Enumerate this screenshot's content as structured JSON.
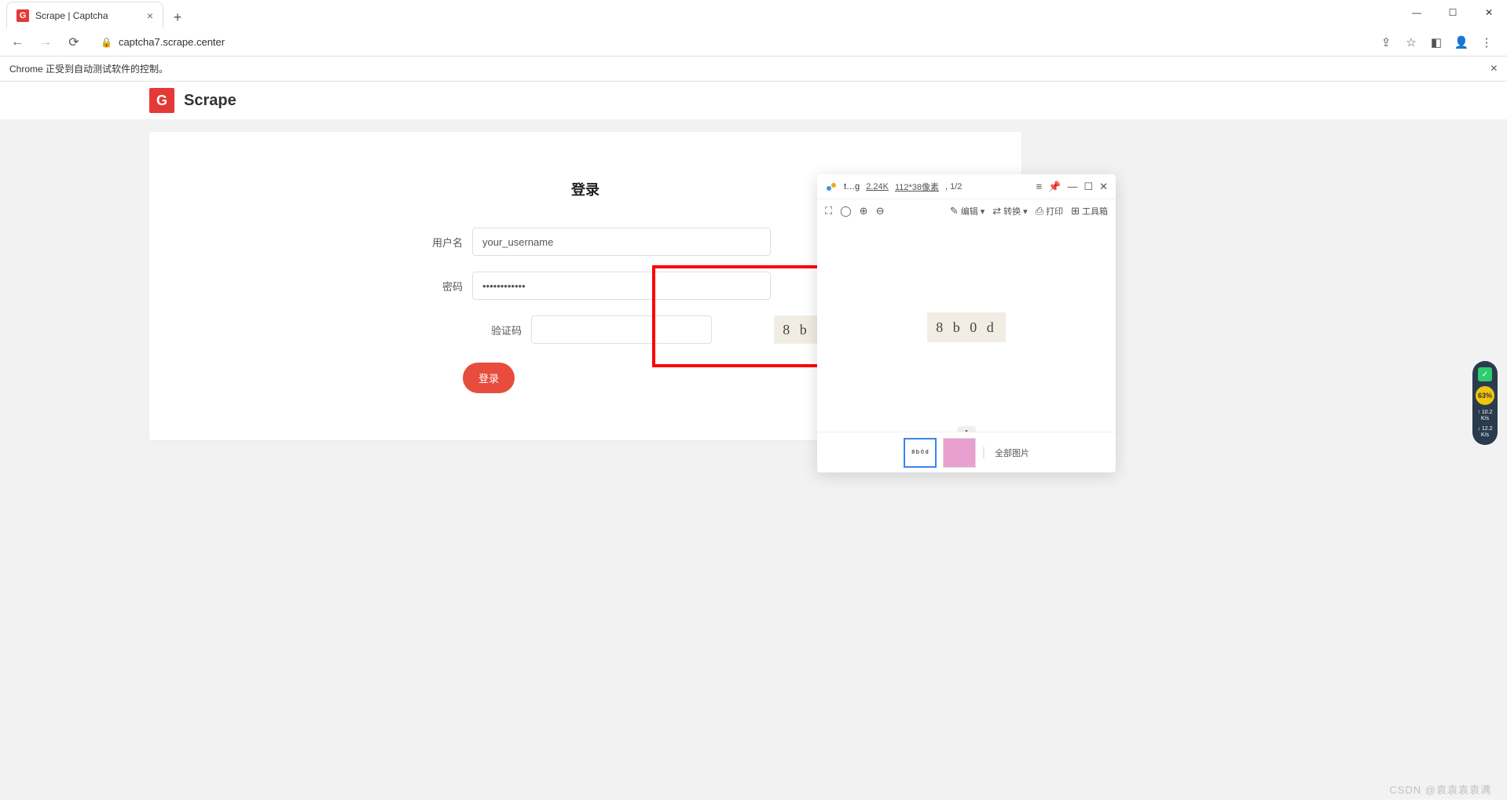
{
  "browser": {
    "tab_title": "Scrape | Captcha",
    "url": "captcha7.scrape.center",
    "automation_notice": "Chrome 正受到自动测试软件的控制。"
  },
  "site": {
    "logo_letter": "G",
    "title": "Scrape"
  },
  "login": {
    "title": "登录",
    "username_label": "用户名",
    "username_value": "your_username",
    "password_label": "密码",
    "password_value": "••••••••••••",
    "captcha_label": "验证码",
    "captcha_text": "8 b 0 d",
    "submit_label": "登录"
  },
  "viewer": {
    "filename": "t…g",
    "filesize": "2.24K",
    "dimensions": "112*38像素",
    "index": "1/2",
    "toolbar": {
      "edit": "编辑",
      "convert": "转换",
      "print": "打印",
      "toolbox": "工具箱"
    },
    "captcha_text": "8 b 0 d",
    "thumb1_text": "8 b 0 d",
    "all_images_label": "全部图片"
  },
  "sys": {
    "percent": "63%",
    "up": "10.2",
    "up_unit": "K/s",
    "down": "12.2",
    "down_unit": "K/s"
  },
  "watermark": "CSDN @袁袁袁袁满"
}
